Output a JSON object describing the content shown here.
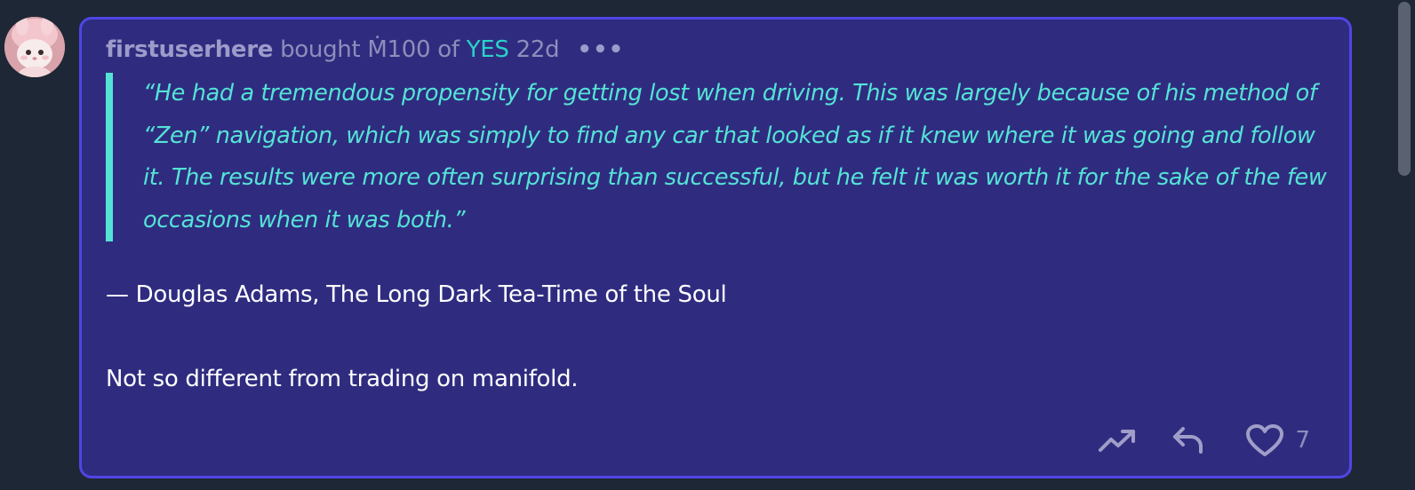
{
  "comment": {
    "author": "firstuserhere",
    "bought_text": "bought",
    "amount": "Ṁ100",
    "of_text": "of",
    "outcome": "YES",
    "time_ago": "22d",
    "more_label": "•••",
    "quote": "“He had a tremendous propensity for getting lost when driving. This was largely because of his method of “Zen” navigation, which was simply to find any car that looked as if it knew where it was going and follow it. The results were more often surprising than successful, but he felt it was worth it for the sake of the few occasions when it was both.”",
    "attribution": "— Douglas Adams, The Long Dark Tea-Time of the Soul",
    "closing": "Not so different from trading on manifold.",
    "like_count": "7"
  },
  "icons": {
    "trend": "trending-up-icon",
    "reply": "reply-icon",
    "like": "heart-icon",
    "more": "ellipsis-icon"
  },
  "colors": {
    "background": "#1e2735",
    "card": "#2f2c80",
    "card_border": "#4f46e5",
    "accent": "#55e3d5",
    "outcome": "#2ad2c9"
  }
}
